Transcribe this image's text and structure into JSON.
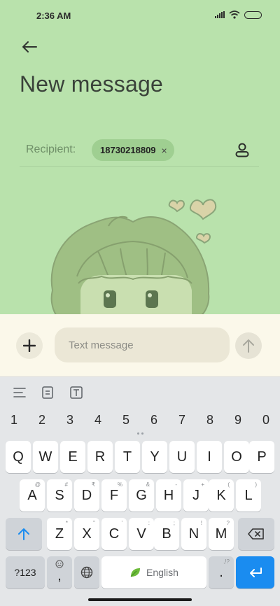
{
  "status_bar": {
    "time": "2:36 AM"
  },
  "header": {
    "title": "New message"
  },
  "recipient": {
    "label": "Recipient:",
    "chip": "18730218809",
    "chip_close": "×"
  },
  "compose": {
    "placeholder": "Text message"
  },
  "keyboard": {
    "numbers": [
      "1",
      "2",
      "3",
      "4",
      "5",
      "6",
      "7",
      "8",
      "9",
      "0"
    ],
    "row1": [
      {
        "k": "Q",
        "s": ""
      },
      {
        "k": "W",
        "s": ""
      },
      {
        "k": "E",
        "s": ""
      },
      {
        "k": "R",
        "s": ""
      },
      {
        "k": "T",
        "s": ""
      },
      {
        "k": "Y",
        "s": ""
      },
      {
        "k": "U",
        "s": ""
      },
      {
        "k": "I",
        "s": ""
      },
      {
        "k": "O",
        "s": ""
      },
      {
        "k": "P",
        "s": ""
      }
    ],
    "row2": [
      {
        "k": "A",
        "s": "@"
      },
      {
        "k": "S",
        "s": "#"
      },
      {
        "k": "D",
        "s": "₹"
      },
      {
        "k": "F",
        "s": "%"
      },
      {
        "k": "G",
        "s": "&"
      },
      {
        "k": "H",
        "s": "-"
      },
      {
        "k": "J",
        "s": "+"
      },
      {
        "k": "K",
        "s": "("
      },
      {
        "k": "L",
        "s": ")"
      }
    ],
    "row3": [
      {
        "k": "Z",
        "s": "*"
      },
      {
        "k": "X",
        "s": "\""
      },
      {
        "k": "C",
        "s": "'"
      },
      {
        "k": "V",
        "s": ":"
      },
      {
        "k": "B",
        "s": ";"
      },
      {
        "k": "N",
        "s": "!"
      },
      {
        "k": "M",
        "s": "?"
      }
    ],
    "symbols_label": "?123",
    "comma_label": ",",
    "space_label": "English",
    "period_label": ".",
    "period_sub": ",!?"
  },
  "colors": {
    "background": "#b9e2ac",
    "chip": "#9fcf91",
    "compose_bg": "#fbf8ea",
    "enter_key": "#1a8cf0"
  }
}
